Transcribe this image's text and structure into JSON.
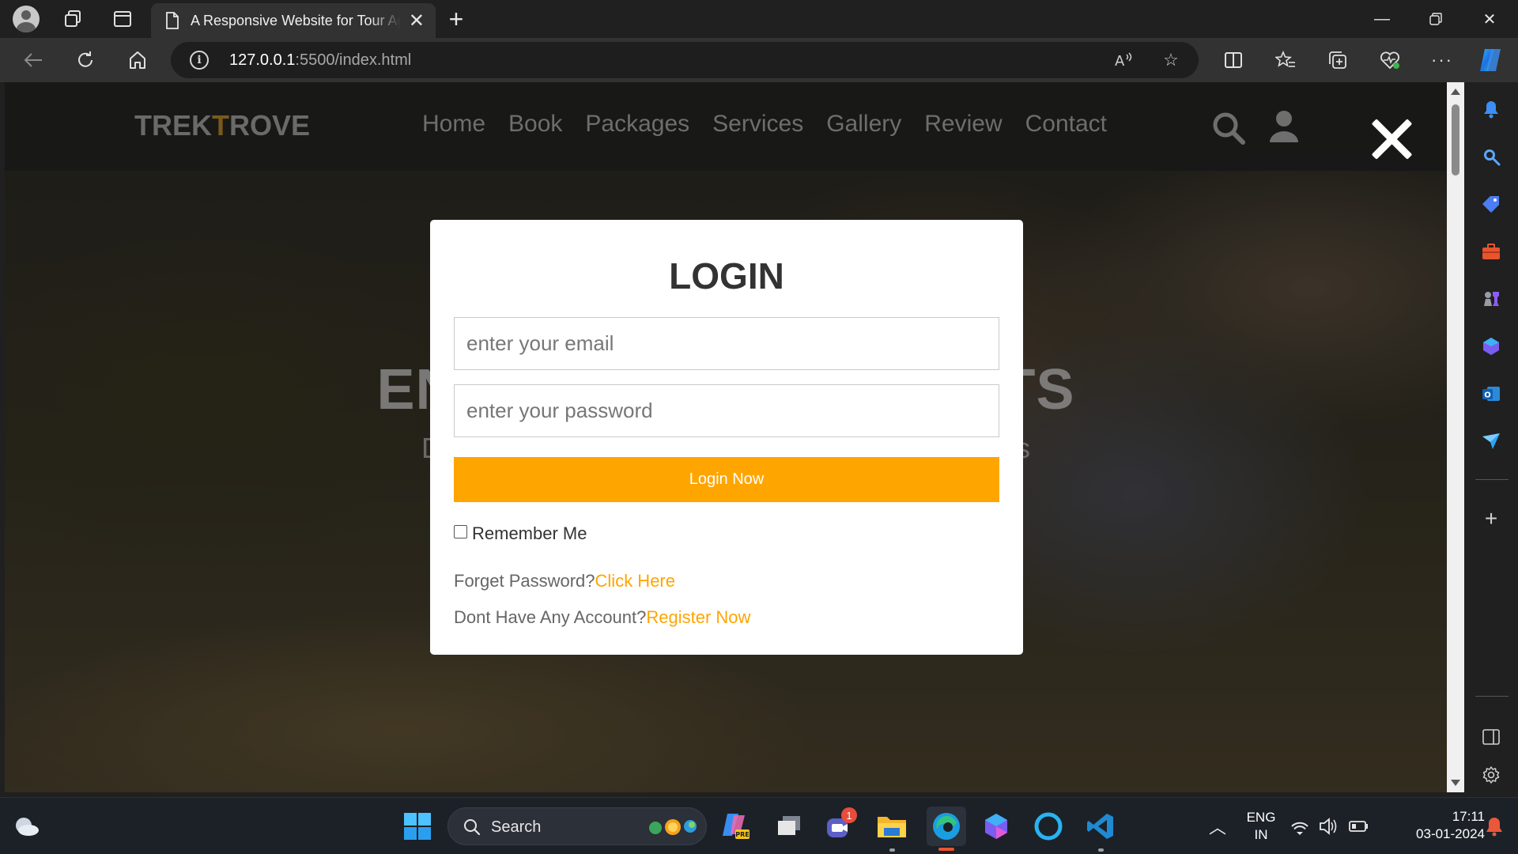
{
  "browser": {
    "tab_title": "A Responsive Website for Tour Agency",
    "url_host": "127.0.0.1",
    "url_rest": ":5500/index.html"
  },
  "site": {
    "logo_part1": "TREK",
    "logo_accent": "T",
    "logo_part2": "ROVE",
    "nav": [
      "Home",
      "Book",
      "Packages",
      "Services",
      "Gallery",
      "Review",
      "Contact"
    ],
    "hero_title_left": "END",
    "hero_title_right": "AITS",
    "hero_sub_left": "Di",
    "hero_sub_right": "its"
  },
  "login": {
    "title": "LOGIN",
    "email_placeholder": "enter your email",
    "password_placeholder": "enter your password",
    "button": "Login Now",
    "remember": "Remember Me",
    "forgot_text": "Forget Password?",
    "forgot_link": "Click Here",
    "register_text": "Dont Have Any Account?",
    "register_link": "Register Now"
  },
  "taskbar": {
    "search_label": "Search",
    "lang_line1": "ENG",
    "lang_line2": "IN",
    "time": "17:11",
    "date": "03-01-2024",
    "teams_badge": "1"
  },
  "colors": {
    "accent": "#ffa500",
    "modal_bg": "#ffffff",
    "browser_chrome": "#202020"
  }
}
